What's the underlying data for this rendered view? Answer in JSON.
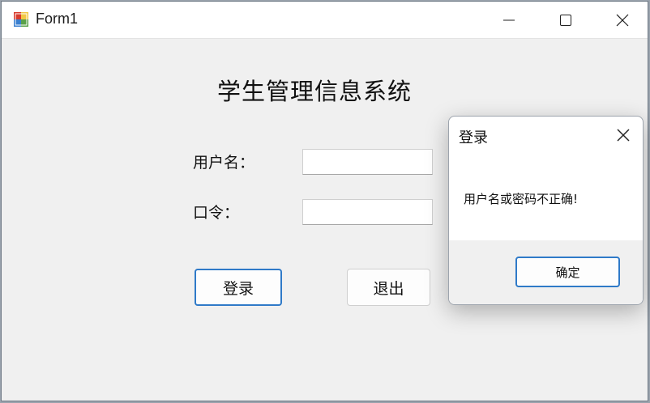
{
  "window": {
    "title": "Form1",
    "icon": "winforms-app-icon",
    "controls": [
      "minimize-icon",
      "maximize-icon",
      "close-icon"
    ]
  },
  "form": {
    "system_title": "学生管理信息系统",
    "username_label": "用户名：",
    "password_label": "口令：",
    "username_value": "",
    "password_value": "",
    "login_button": "登录",
    "exit_button": "退出"
  },
  "dialog": {
    "title": "登录",
    "message": "用户名或密码不正确!",
    "ok_button": "确定"
  },
  "colors": {
    "form_background": "#f0f0f0",
    "focus_border": "#2f7ac8",
    "titlebar": "#ffffff"
  }
}
